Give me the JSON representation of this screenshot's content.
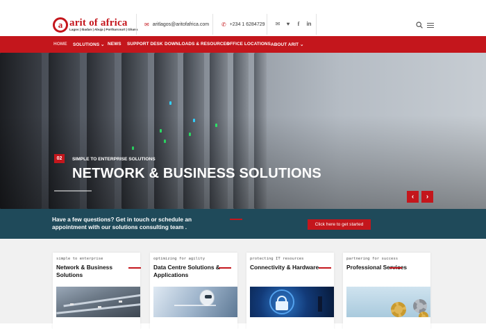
{
  "brand": {
    "logo_letter": "a",
    "name": "arit of africa",
    "tagline": "Lagos | Ibadan | Abuja | Portharcourt | Ghana",
    "accent": "#c4161c",
    "dark_band": "#1f4a5a"
  },
  "header": {
    "email": "aritlagos@aritofafrica.com",
    "phone": "+234 1 6284729",
    "email_icon": "mail-icon",
    "phone_icon": "phone-icon",
    "social_icons": [
      "mail-icon",
      "twitter-icon",
      "facebook-icon",
      "linkedin-icon"
    ]
  },
  "nav": {
    "items": [
      {
        "label": "HOME",
        "active": true
      },
      {
        "label": "SOLUTIONS ⌄",
        "active": false
      },
      {
        "label": "NEWS",
        "active": false
      },
      {
        "label": "SUPPORT DESK",
        "active": false
      },
      {
        "label": "DOWNLOADS & RESOURCES",
        "active": false
      },
      {
        "label": "OFFICE LOCATIONS",
        "active": false
      },
      {
        "label": "ABOUT ARIT ⌄",
        "active": false
      }
    ]
  },
  "hero": {
    "slide_number": "02",
    "subtitle": "SIMPLE TO ENTERPRISE SOLUTIONS",
    "title": "NETWORK & BUSINESS SOLUTIONS",
    "prev": "‹",
    "next": "›"
  },
  "cta": {
    "text": "Have a few questions? Get in touch or schedule an appointment with our solutions consulting team .",
    "button": "Click here to get started"
  },
  "cards": [
    {
      "kicker": "simple to enterprise",
      "title": "Network & Business Solutions"
    },
    {
      "kicker": "optimizing for agility",
      "title": "Data Centre Solutions & Applications"
    },
    {
      "kicker": "protecting IT resources",
      "title": "Connectivity & Hardware"
    },
    {
      "kicker": "partnering for success",
      "title": "Professional Services"
    }
  ]
}
